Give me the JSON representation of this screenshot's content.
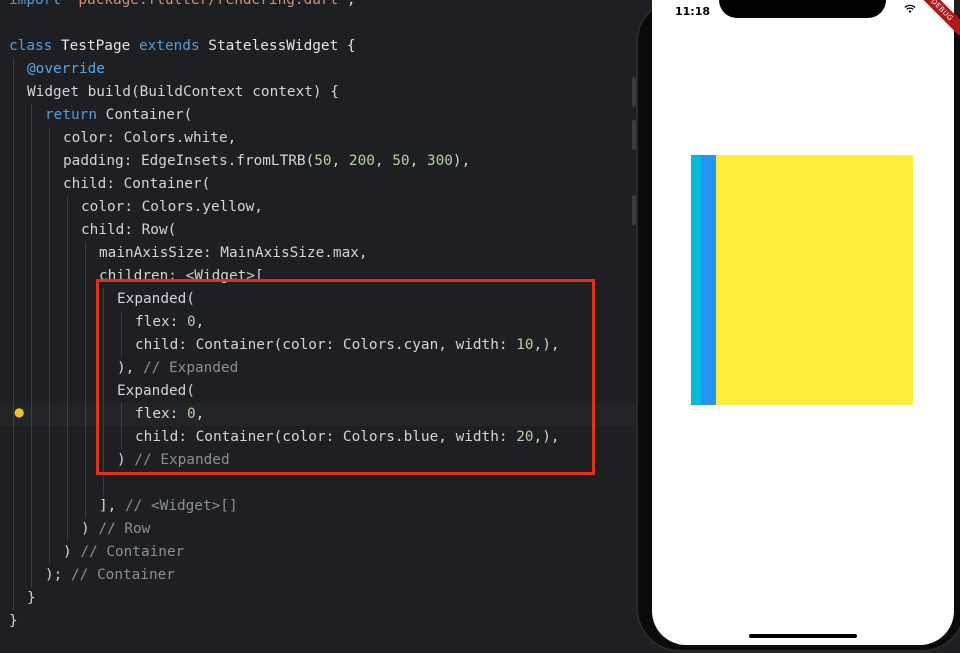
{
  "code": {
    "line0": {
      "t1": "import ",
      "t2": "'package:flutter/rendering.dart'",
      "t3": ";"
    },
    "line1": {
      "t1": "class ",
      "t2": "TestPage ",
      "t3": "extends ",
      "t4": "StatelessWidget {"
    },
    "line2": {
      "t1": "@override"
    },
    "line3": {
      "t1": "Widget build(BuildContext context) {"
    },
    "line4": {
      "t1": "return ",
      "t2": "Container("
    },
    "line5": {
      "t1": "color: Colors.white,"
    },
    "line6": {
      "t1": "padding: EdgeInsets.fromLTRB(",
      "n1": "50",
      "s1": ", ",
      "n2": "200",
      "s2": ", ",
      "n3": "50",
      "s3": ", ",
      "n4": "300",
      "t2": "),"
    },
    "line7": {
      "t1": "child: Container("
    },
    "line8": {
      "t1": "color: Colors.yellow,"
    },
    "line9": {
      "t1": "child: Row("
    },
    "line10": {
      "t1": "mainAxisSize: MainAxisSize.max,"
    },
    "line11": {
      "t1": "children: <Widget>["
    },
    "line12": {
      "t1": "Expanded("
    },
    "line13": {
      "t1": "flex: ",
      "n1": "0",
      "t2": ","
    },
    "line14": {
      "t1": "child: Container(color: Colors.cyan, width: ",
      "n1": "10",
      "t2": ",),"
    },
    "line15": {
      "t1": "), ",
      "c1": "// Expanded"
    },
    "line16": {
      "t1": "Expanded("
    },
    "line17": {
      "t1": "flex: ",
      "n1": "0",
      "t2": ","
    },
    "line18": {
      "t1": "child: Container(color: Colors.blue, width: ",
      "n1": "20",
      "t2": ",),"
    },
    "line19": {
      "t1": ") ",
      "c1": "// Expanded"
    },
    "line20": {
      "t1": "], ",
      "c1": "// <Widget>[]"
    },
    "line21": {
      "t1": ") ",
      "c1": "// Row"
    },
    "line22": {
      "t1": ") ",
      "c1": "// Container"
    },
    "line23": {
      "t1": "); ",
      "c1": "// Container"
    },
    "line24": {
      "t1": "}"
    },
    "line25": {
      "t1": "}"
    }
  },
  "phone": {
    "time": "11:18",
    "debug_banner": "DEBUG",
    "colors": {
      "yellow": "#ffeb3b",
      "cyan": "#00bcd4",
      "blue": "#2196f3"
    }
  },
  "highlight_color": "#e0301e"
}
